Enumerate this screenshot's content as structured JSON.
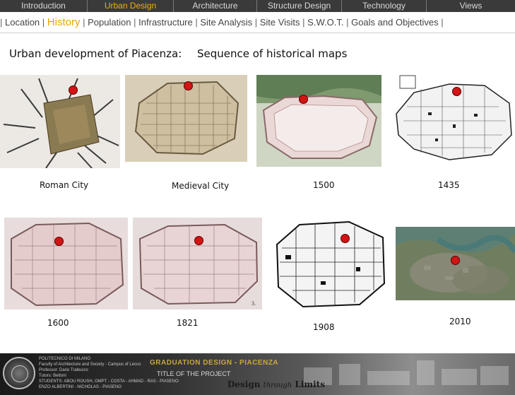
{
  "topnav": {
    "tabs": [
      {
        "label": "Introduction",
        "active": false
      },
      {
        "label": "Urban Design",
        "active": true
      },
      {
        "label": "Architecture",
        "active": false
      },
      {
        "label": "Structure Design",
        "active": false
      },
      {
        "label": "Technology",
        "active": false
      },
      {
        "label": "Views",
        "active": false
      }
    ]
  },
  "subnav": {
    "items": [
      {
        "label": "Location",
        "active": false
      },
      {
        "label": "History",
        "active": true
      },
      {
        "label": "Population",
        "active": false
      },
      {
        "label": "Infrastructure",
        "active": false
      },
      {
        "label": "Site Analysis",
        "active": false
      },
      {
        "label": "Site Visits",
        "active": false
      },
      {
        "label": "S.W.O.T.",
        "active": false
      },
      {
        "label": "Goals and Objectives",
        "active": false
      }
    ],
    "separator": "|"
  },
  "headings": {
    "left": "Urban development of Piacenza:",
    "right": "Sequence of historical maps"
  },
  "maps": [
    {
      "caption": "Roman City",
      "style": "roman"
    },
    {
      "caption": "Medieval City",
      "style": "medieval"
    },
    {
      "caption": "1500",
      "style": "fort-green"
    },
    {
      "caption": "1435",
      "style": "sketch"
    },
    {
      "caption": "1600",
      "style": "fort-pink"
    },
    {
      "caption": "1821",
      "style": "fort-pink"
    },
    {
      "caption": "1908",
      "style": "plan-bw"
    },
    {
      "caption": "2010",
      "style": "satellite"
    }
  ],
  "footer": {
    "university_lines": [
      "POLITECNICO DI MILANO",
      "Faculty of Architecture and Society - Campus of Lecco",
      "Professor: Dario Trabucco",
      "Tutors: Bettoni",
      "STUDENTS: ABOU ROUSH, OMPT - COSTA - AHMAD - RAS - PIASENO",
      "ENZO ALBERTINI - NICHOLAS - PIASENO"
    ],
    "title": "GRADUATION DESIGN - PIACENZA",
    "project": "TITLE OF THE PROJECT",
    "motto_a": "Design",
    "motto_b": "through",
    "motto_c": "Limits"
  },
  "colors": {
    "active_tab": "#f0b000",
    "active_subnav": "#e8a800",
    "marker": "#d21414"
  }
}
